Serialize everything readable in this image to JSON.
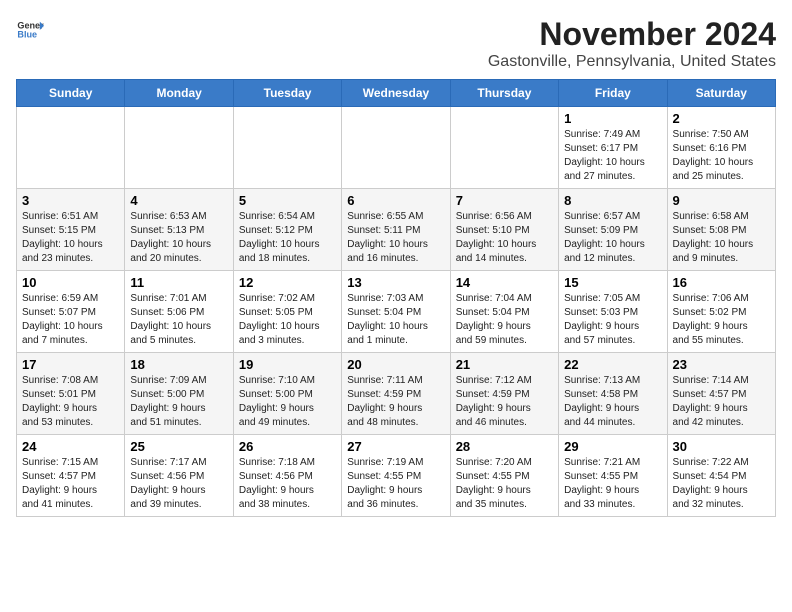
{
  "logo": {
    "general": "General",
    "blue": "Blue"
  },
  "title": "November 2024",
  "subtitle": "Gastonville, Pennsylvania, United States",
  "days_header": [
    "Sunday",
    "Monday",
    "Tuesday",
    "Wednesday",
    "Thursday",
    "Friday",
    "Saturday"
  ],
  "weeks": [
    [
      {
        "day": "",
        "info": ""
      },
      {
        "day": "",
        "info": ""
      },
      {
        "day": "",
        "info": ""
      },
      {
        "day": "",
        "info": ""
      },
      {
        "day": "",
        "info": ""
      },
      {
        "day": "1",
        "info": "Sunrise: 7:49 AM\nSunset: 6:17 PM\nDaylight: 10 hours\nand 27 minutes."
      },
      {
        "day": "2",
        "info": "Sunrise: 7:50 AM\nSunset: 6:16 PM\nDaylight: 10 hours\nand 25 minutes."
      }
    ],
    [
      {
        "day": "3",
        "info": "Sunrise: 6:51 AM\nSunset: 5:15 PM\nDaylight: 10 hours\nand 23 minutes."
      },
      {
        "day": "4",
        "info": "Sunrise: 6:53 AM\nSunset: 5:13 PM\nDaylight: 10 hours\nand 20 minutes."
      },
      {
        "day": "5",
        "info": "Sunrise: 6:54 AM\nSunset: 5:12 PM\nDaylight: 10 hours\nand 18 minutes."
      },
      {
        "day": "6",
        "info": "Sunrise: 6:55 AM\nSunset: 5:11 PM\nDaylight: 10 hours\nand 16 minutes."
      },
      {
        "day": "7",
        "info": "Sunrise: 6:56 AM\nSunset: 5:10 PM\nDaylight: 10 hours\nand 14 minutes."
      },
      {
        "day": "8",
        "info": "Sunrise: 6:57 AM\nSunset: 5:09 PM\nDaylight: 10 hours\nand 12 minutes."
      },
      {
        "day": "9",
        "info": "Sunrise: 6:58 AM\nSunset: 5:08 PM\nDaylight: 10 hours\nand 9 minutes."
      }
    ],
    [
      {
        "day": "10",
        "info": "Sunrise: 6:59 AM\nSunset: 5:07 PM\nDaylight: 10 hours\nand 7 minutes."
      },
      {
        "day": "11",
        "info": "Sunrise: 7:01 AM\nSunset: 5:06 PM\nDaylight: 10 hours\nand 5 minutes."
      },
      {
        "day": "12",
        "info": "Sunrise: 7:02 AM\nSunset: 5:05 PM\nDaylight: 10 hours\nand 3 minutes."
      },
      {
        "day": "13",
        "info": "Sunrise: 7:03 AM\nSunset: 5:04 PM\nDaylight: 10 hours\nand 1 minute."
      },
      {
        "day": "14",
        "info": "Sunrise: 7:04 AM\nSunset: 5:04 PM\nDaylight: 9 hours\nand 59 minutes."
      },
      {
        "day": "15",
        "info": "Sunrise: 7:05 AM\nSunset: 5:03 PM\nDaylight: 9 hours\nand 57 minutes."
      },
      {
        "day": "16",
        "info": "Sunrise: 7:06 AM\nSunset: 5:02 PM\nDaylight: 9 hours\nand 55 minutes."
      }
    ],
    [
      {
        "day": "17",
        "info": "Sunrise: 7:08 AM\nSunset: 5:01 PM\nDaylight: 9 hours\nand 53 minutes."
      },
      {
        "day": "18",
        "info": "Sunrise: 7:09 AM\nSunset: 5:00 PM\nDaylight: 9 hours\nand 51 minutes."
      },
      {
        "day": "19",
        "info": "Sunrise: 7:10 AM\nSunset: 5:00 PM\nDaylight: 9 hours\nand 49 minutes."
      },
      {
        "day": "20",
        "info": "Sunrise: 7:11 AM\nSunset: 4:59 PM\nDaylight: 9 hours\nand 48 minutes."
      },
      {
        "day": "21",
        "info": "Sunrise: 7:12 AM\nSunset: 4:59 PM\nDaylight: 9 hours\nand 46 minutes."
      },
      {
        "day": "22",
        "info": "Sunrise: 7:13 AM\nSunset: 4:58 PM\nDaylight: 9 hours\nand 44 minutes."
      },
      {
        "day": "23",
        "info": "Sunrise: 7:14 AM\nSunset: 4:57 PM\nDaylight: 9 hours\nand 42 minutes."
      }
    ],
    [
      {
        "day": "24",
        "info": "Sunrise: 7:15 AM\nSunset: 4:57 PM\nDaylight: 9 hours\nand 41 minutes."
      },
      {
        "day": "25",
        "info": "Sunrise: 7:17 AM\nSunset: 4:56 PM\nDaylight: 9 hours\nand 39 minutes."
      },
      {
        "day": "26",
        "info": "Sunrise: 7:18 AM\nSunset: 4:56 PM\nDaylight: 9 hours\nand 38 minutes."
      },
      {
        "day": "27",
        "info": "Sunrise: 7:19 AM\nSunset: 4:55 PM\nDaylight: 9 hours\nand 36 minutes."
      },
      {
        "day": "28",
        "info": "Sunrise: 7:20 AM\nSunset: 4:55 PM\nDaylight: 9 hours\nand 35 minutes."
      },
      {
        "day": "29",
        "info": "Sunrise: 7:21 AM\nSunset: 4:55 PM\nDaylight: 9 hours\nand 33 minutes."
      },
      {
        "day": "30",
        "info": "Sunrise: 7:22 AM\nSunset: 4:54 PM\nDaylight: 9 hours\nand 32 minutes."
      }
    ]
  ]
}
